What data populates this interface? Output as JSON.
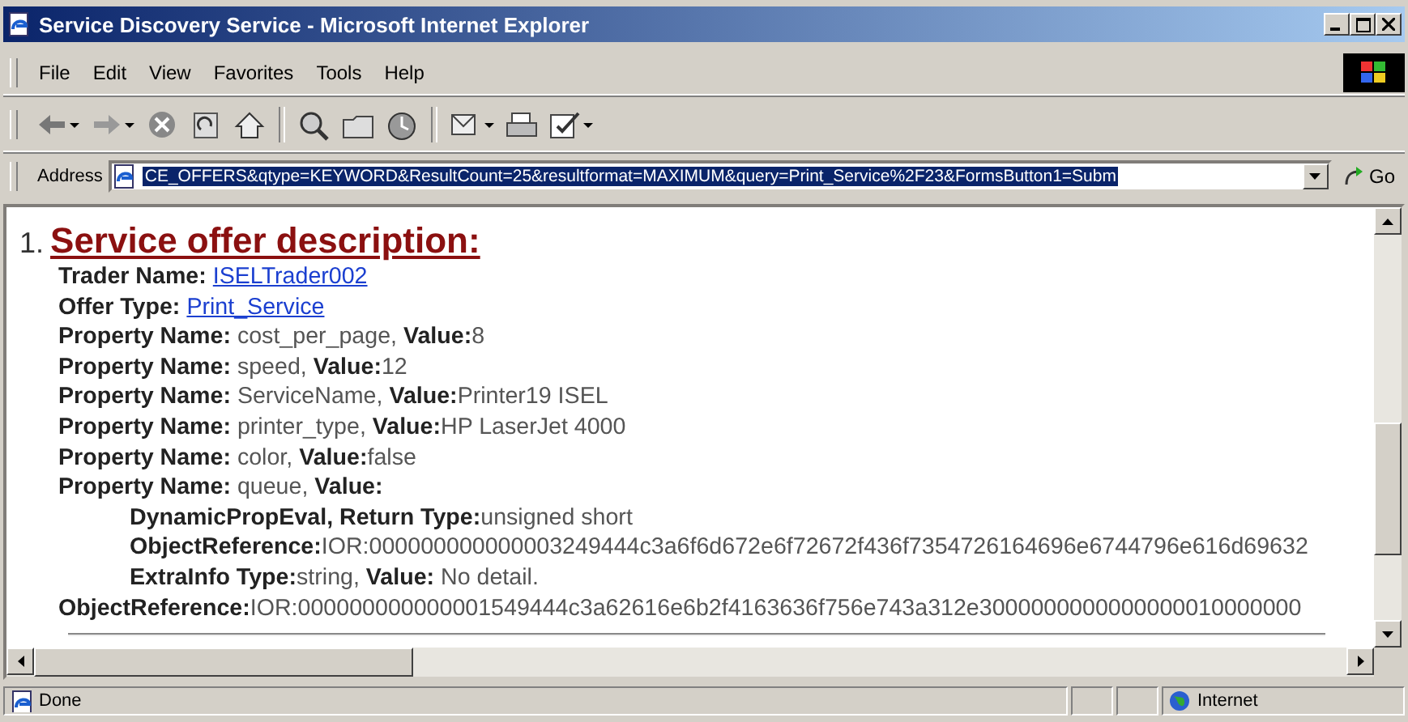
{
  "window": {
    "title": "Service Discovery Service - Microsoft Internet Explorer"
  },
  "menu": [
    "File",
    "Edit",
    "View",
    "Favorites",
    "Tools",
    "Help"
  ],
  "address": {
    "label": "Address",
    "value": "CE_OFFERS&qtype=KEYWORD&ResultCount=25&resultformat=MAXIMUM&query=Print_Service%2F23&FormsButton1=Subm",
    "selected": true,
    "go": "Go"
  },
  "content": {
    "number": "1.",
    "heading": "Service offer description:",
    "lines": [
      {
        "kind": "link",
        "label": "Trader Name:",
        "link": "ISELTrader002"
      },
      {
        "kind": "link",
        "label": "Offer Type:",
        "link": "Print_Service"
      },
      {
        "kind": "text",
        "text": "**Property Name:** cost_per_page, **Value:**8"
      },
      {
        "kind": "text",
        "text": "**Property Name:** speed, **Value:**12"
      },
      {
        "kind": "text",
        "text": "**Property Name:** ServiceName, **Value:**Printer19 ISEL"
      },
      {
        "kind": "text",
        "text": "**Property Name:** printer_type, **Value:**HP LaserJet 4000"
      },
      {
        "kind": "text",
        "text": "**Property Name:** color, **Value:**false"
      },
      {
        "kind": "text",
        "text": "**Property Name:** queue, **Value:**",
        "children": [
          {
            "kind": "text",
            "text": "**DynamicPropEval, Return Type:**unsigned short"
          },
          {
            "kind": "text",
            "text": "**ObjectReference:**IOR:000000000000003249444c3a6f6d672e6f72672f436f7354726164696e6744796e616d69632"
          },
          {
            "kind": "text",
            "text": "**ExtraInfo Type:**string, **Value:** No detail."
          }
        ]
      },
      {
        "kind": "text",
        "text": "**ObjectReference:**IOR:000000000000001549444c3a62616e6b2f4163636f756e743a312e3000000000000000010000000"
      }
    ]
  },
  "status_bar": {
    "text": "Done",
    "zone": "Internet"
  }
}
